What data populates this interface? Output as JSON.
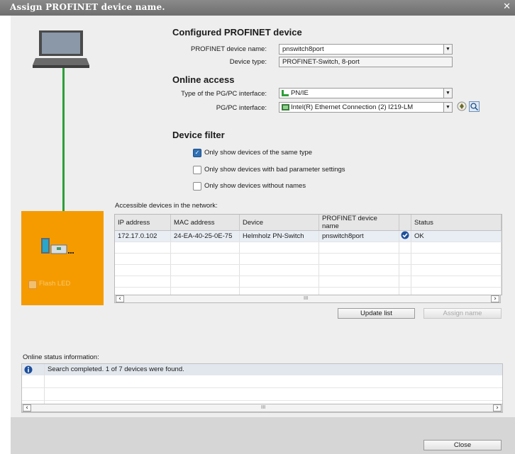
{
  "window": {
    "title": "Assign PROFINET device name.",
    "close_glyph": "✕"
  },
  "configured": {
    "heading": "Configured PROFINET device",
    "name_label": "PROFINET device name:",
    "name_value": "pnswitch8port",
    "type_label": "Device type:",
    "type_value": "PROFINET-Switch, 8-port"
  },
  "online": {
    "heading": "Online access",
    "iface_type_label": "Type of the PG/PC interface:",
    "iface_type_value": "PN/IE",
    "iface_label": "PG/PC interface:",
    "iface_value": "Intel(R) Ethernet Connection (2) I219-LM"
  },
  "filter": {
    "heading": "Device filter",
    "options": [
      {
        "label": "Only show devices of the same type",
        "checked": true
      },
      {
        "label": "Only show devices with bad parameter settings",
        "checked": false
      },
      {
        "label": "Only show devices without names",
        "checked": false
      }
    ]
  },
  "device_panel": {
    "flash_label": "Flash LED",
    "accent": "#f59b00"
  },
  "devices": {
    "caption": "Accessible devices in the network:",
    "columns": [
      "IP address",
      "MAC address",
      "Device",
      "PROFINET device name",
      "Status"
    ],
    "rows": [
      {
        "ip": "172.17.0.102",
        "mac": "24-EA-40-25-0E-75",
        "device": "Helmholz PN-Switch",
        "name": "pnswitch8port",
        "status": "OK"
      }
    ],
    "scroll_mid": "III"
  },
  "buttons": {
    "update": "Update list",
    "assign": "Assign name",
    "close": "Close"
  },
  "status": {
    "caption": "Online status information:",
    "message": "Search completed. 1 of 7 devices were found.",
    "scroll_mid": "III"
  },
  "colors": {
    "green_line": "#2e9e3a",
    "orange": "#f59b00",
    "ok_blue": "#1d4f9c"
  }
}
